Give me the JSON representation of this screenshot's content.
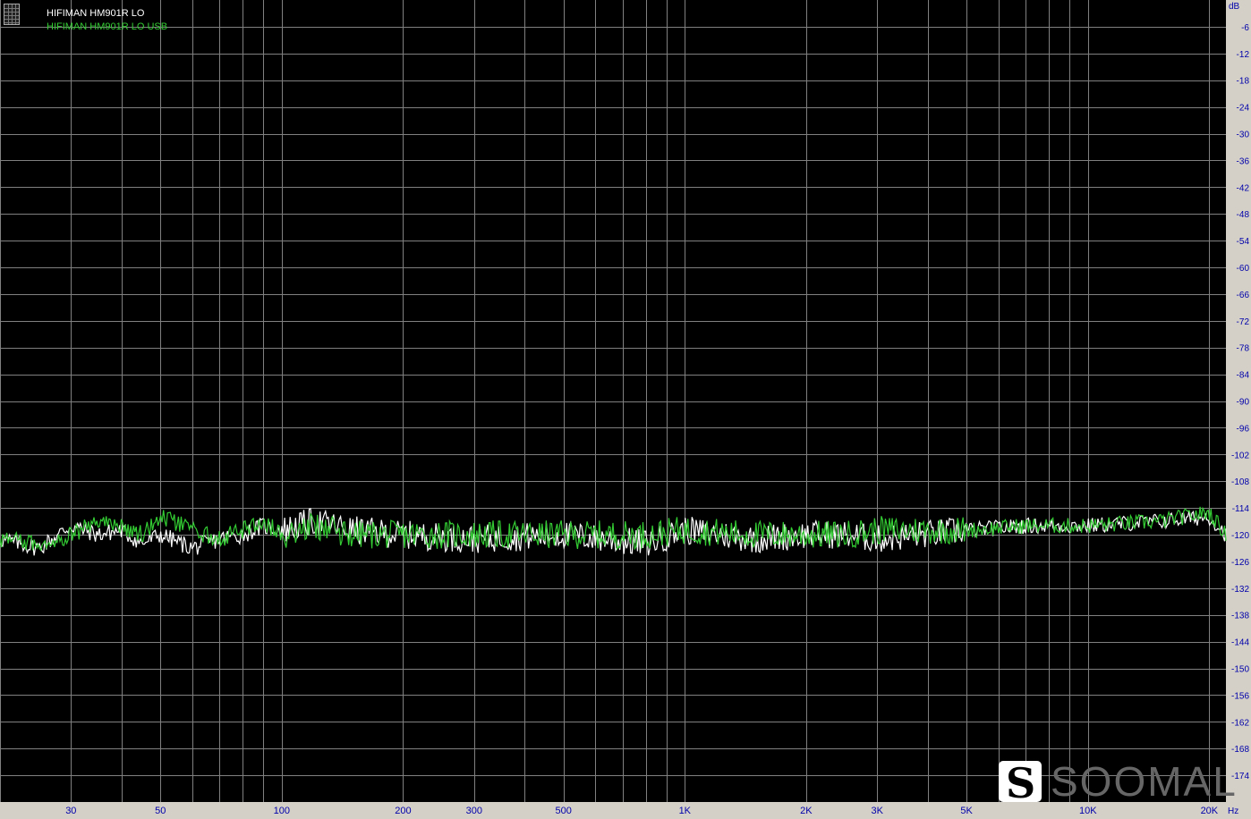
{
  "legend": [
    {
      "label": "HIFIMAN HM901R LO",
      "color": "#ffffff"
    },
    {
      "label": "HIFIMAN HM901R LO USB",
      "color": "#33cc33"
    }
  ],
  "watermark": {
    "logo_letter": "S",
    "text": "SOOMAL"
  },
  "chart_data": {
    "type": "line",
    "title": "",
    "xlabel": "Hz",
    "ylabel": "dB",
    "xscale": "log",
    "xlim": [
      20,
      22000
    ],
    "ylim": [
      -180,
      0
    ],
    "grid": true,
    "x_ticks": [
      {
        "value": 30,
        "label": "30"
      },
      {
        "value": 50,
        "label": "50"
      },
      {
        "value": 100,
        "label": "100"
      },
      {
        "value": 200,
        "label": "200"
      },
      {
        "value": 300,
        "label": "300"
      },
      {
        "value": 500,
        "label": "500"
      },
      {
        "value": 1000,
        "label": "1K"
      },
      {
        "value": 2000,
        "label": "2K"
      },
      {
        "value": 3000,
        "label": "3K"
      },
      {
        "value": 5000,
        "label": "5K"
      },
      {
        "value": 10000,
        "label": "10K"
      },
      {
        "value": 20000,
        "label": "20K"
      }
    ],
    "y_ticks": [
      -6,
      -12,
      -18,
      -24,
      -30,
      -36,
      -42,
      -48,
      -54,
      -60,
      -66,
      -72,
      -78,
      -84,
      -90,
      -96,
      -102,
      -108,
      -114,
      -120,
      -126,
      -132,
      -138,
      -144,
      -150,
      -156,
      -162,
      -168,
      -174
    ],
    "series": [
      {
        "name": "HIFIMAN HM901R LO",
        "color": "#ffffff",
        "x": [
          20,
          25,
          30,
          35,
          40,
          45,
          50,
          60,
          70,
          80,
          90,
          100,
          120,
          150,
          200,
          300,
          500,
          800,
          1000,
          1500,
          2000,
          2500,
          3000,
          5000,
          7000,
          10000,
          15000,
          20000,
          22000
        ],
        "y": [
          -121,
          -123,
          -118,
          -120,
          -119,
          -122,
          -120,
          -123,
          -121,
          -120,
          -118,
          -119,
          -117,
          -119,
          -120,
          -121,
          -120,
          -122,
          -119,
          -121,
          -120,
          -120,
          -121,
          -119,
          -118,
          -118,
          -117,
          -116,
          -120
        ]
      },
      {
        "name": "HIFIMAN HM901R LO USB",
        "color": "#33cc33",
        "x": [
          20,
          25,
          30,
          35,
          40,
          45,
          50,
          60,
          70,
          80,
          90,
          100,
          120,
          150,
          200,
          300,
          500,
          800,
          1000,
          1500,
          2000,
          2500,
          3000,
          5000,
          7000,
          10000,
          15000,
          20000,
          22000
        ],
        "y": [
          -121,
          -122,
          -120,
          -117,
          -118,
          -120,
          -116,
          -119,
          -121,
          -119,
          -117,
          -120,
          -118,
          -120,
          -120,
          -120,
          -120,
          -120,
          -119,
          -120,
          -120,
          -120,
          -119,
          -119,
          -118,
          -118,
          -117,
          -115,
          -120
        ]
      }
    ]
  }
}
